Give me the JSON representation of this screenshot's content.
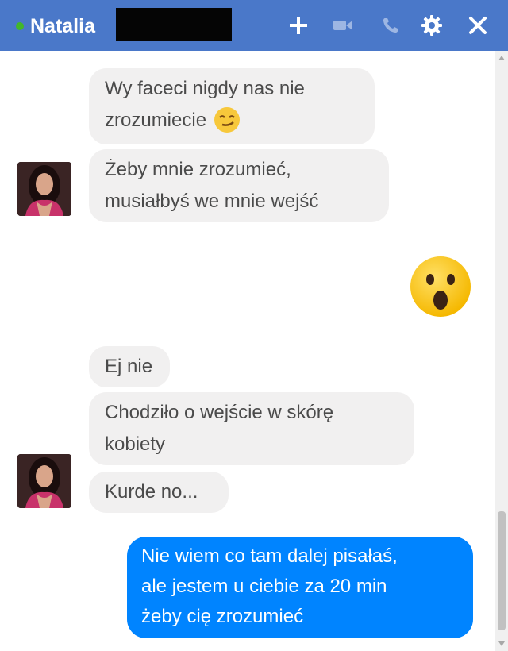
{
  "header": {
    "contact_name": "Natalia",
    "status": "online",
    "bar_color": "#4a78c9",
    "icons": [
      "plus-icon",
      "video-camera-icon",
      "phone-icon",
      "gear-icon",
      "close-icon"
    ]
  },
  "messages": [
    {
      "from": "Natalia",
      "text_lines": [
        "Wy faceci nigdy nas nie",
        "zrozumiecie"
      ],
      "emoji": "smirk-emoji"
    },
    {
      "from": "Natalia",
      "text_lines": [
        "Żeby mnie zrozumieć,",
        "musiałbyś we mnie wejść"
      ]
    },
    {
      "from": "me",
      "emoji": "surprised-emoji"
    },
    {
      "from": "Natalia",
      "text_lines": [
        "Ej nie"
      ]
    },
    {
      "from": "Natalia",
      "text_lines": [
        "Chodziło o wejście w skórę",
        "kobiety"
      ]
    },
    {
      "from": "Natalia",
      "text_lines": [
        "Kurde no..."
      ]
    },
    {
      "from": "me",
      "text_lines": [
        "Nie wiem co tam dalej pisałaś,",
        "ale jestem u ciebie za 20 min",
        "żeby cię zrozumieć"
      ]
    }
  ],
  "colors": {
    "incoming_bubble": "#f1f0f0",
    "outgoing_bubble": "#0084ff",
    "online_dot": "#42b72a"
  }
}
